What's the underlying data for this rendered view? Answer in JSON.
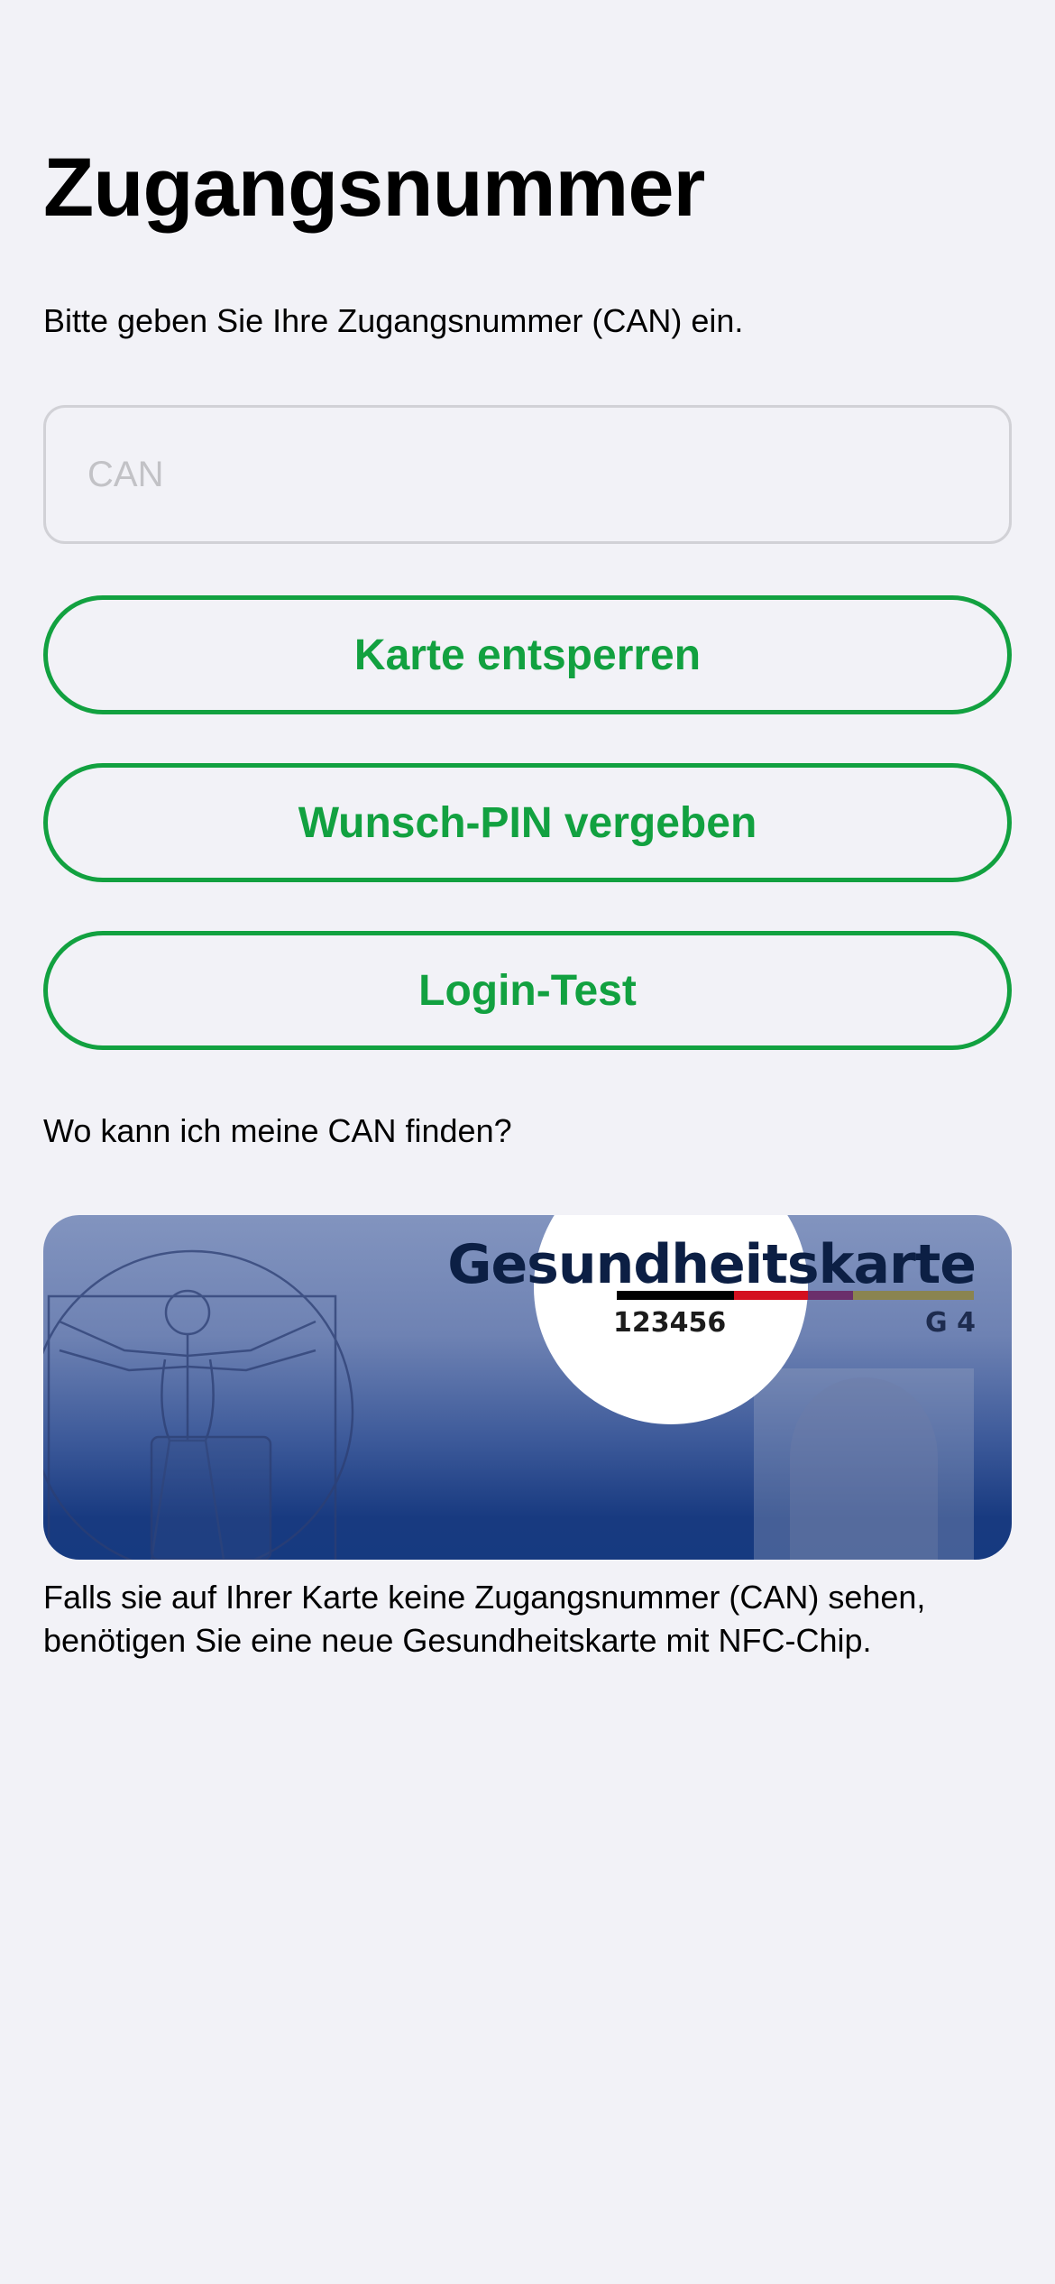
{
  "title": "Zugangsnummer",
  "subtitle": "Bitte geben Sie Ihre Zugangsnummer (CAN) ein.",
  "can_field": {
    "value": "",
    "placeholder": "CAN"
  },
  "buttons": {
    "unlock_card": "Karte entsperren",
    "set_pin": "Wunsch-PIN vergeben",
    "login_test": "Login-Test"
  },
  "help_question": "Wo kann ich meine CAN finden?",
  "card_illustration": {
    "card_title": "Gesundheitskarte",
    "can_number": "123456",
    "generation": "G 4"
  },
  "note": "Falls sie auf Ihrer Karte keine Zugangsnummer (CAN) sehen, benötigen Sie eine neue Gesundheitskarte mit NFC-Chip.",
  "colors": {
    "accent": "#12a140",
    "background": "#f2f2f7",
    "card_blue": "#163a80",
    "highlight": "#ffffff"
  },
  "icons": {
    "card_figure": "vitruvian-man-icon",
    "photo": "portrait-photo-icon",
    "flag_stripe": "german-flag-stripe"
  }
}
